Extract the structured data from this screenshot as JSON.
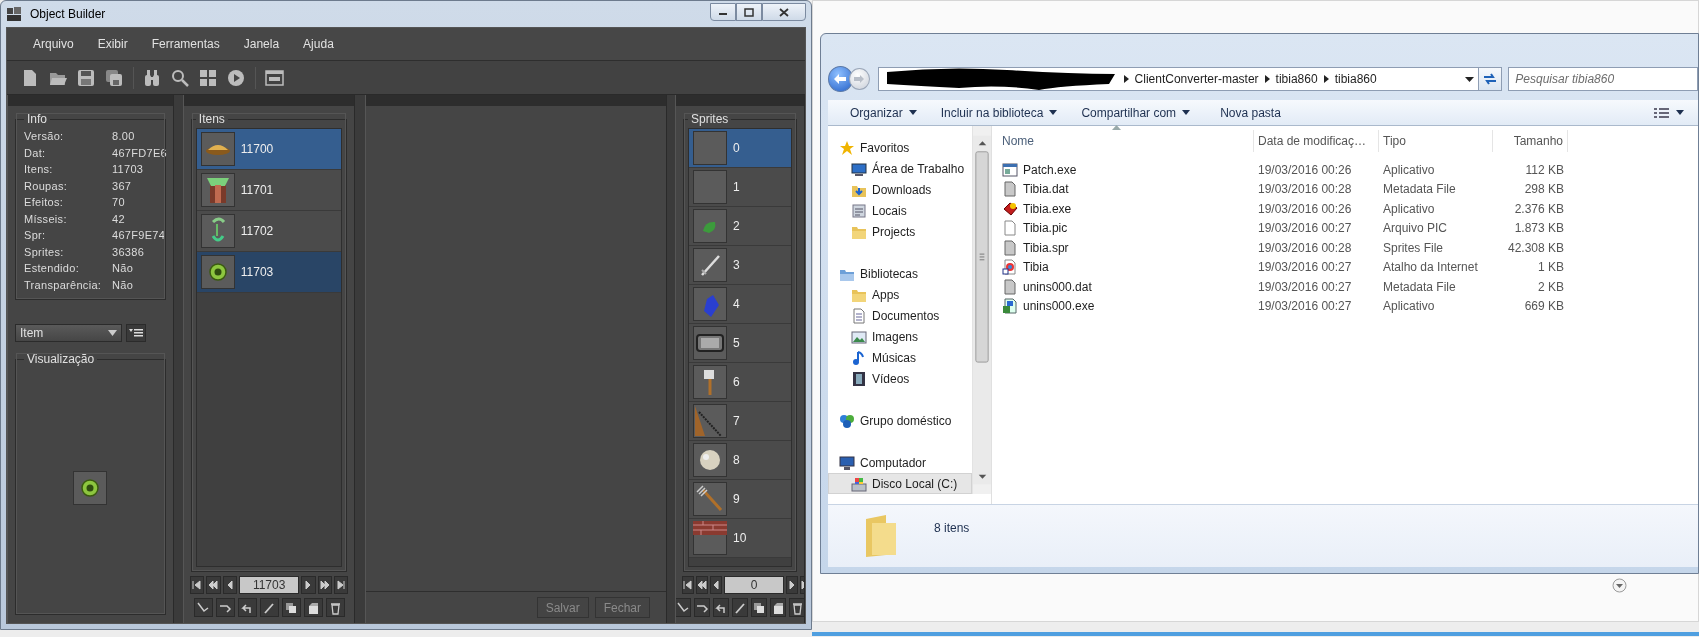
{
  "object_builder": {
    "title": "Object Builder",
    "menu": [
      "Arquivo",
      "Exibir",
      "Ferramentas",
      "Janela",
      "Ajuda"
    ],
    "info": {
      "title": "Info",
      "fields": [
        {
          "label": "Versão:",
          "value": "8.00"
        },
        {
          "label": "Dat:",
          "value": "467FD7E6"
        },
        {
          "label": "Itens:",
          "value": "11703"
        },
        {
          "label": "Roupas:",
          "value": "367"
        },
        {
          "label": "Efeitos:",
          "value": "70"
        },
        {
          "label": "Mísseis:",
          "value": "42"
        },
        {
          "label": "Spr:",
          "value": "467F9E74"
        },
        {
          "label": "Sprites:",
          "value": "36386"
        },
        {
          "label": "Estendido:",
          "value": "Não"
        },
        {
          "label": "Transparência:",
          "value": "Não"
        }
      ]
    },
    "category": {
      "value": "Item"
    },
    "preview": {
      "title": "Visualização",
      "kind": "shield"
    },
    "items": {
      "title": "Itens",
      "rows": [
        {
          "id": "11700",
          "kind": "hat",
          "selected": false,
          "hovered": true
        },
        {
          "id": "11701",
          "kind": "armor",
          "selected": false,
          "hovered": false
        },
        {
          "id": "11702",
          "kind": "amulet",
          "selected": false,
          "hovered": false
        },
        {
          "id": "11703",
          "kind": "shield",
          "selected": true,
          "hovered": false
        }
      ],
      "page": "11703"
    },
    "editor": {
      "buttons": [
        {
          "label": "Salvar",
          "disabled": true
        },
        {
          "label": "Fechar",
          "disabled": true
        }
      ]
    },
    "sprites": {
      "title": "Sprites",
      "rows": [
        {
          "id": "0",
          "kind": "empty",
          "selected": true
        },
        {
          "id": "1",
          "kind": "empty",
          "selected": false
        },
        {
          "id": "2",
          "kind": "leaf",
          "selected": false
        },
        {
          "id": "3",
          "kind": "sword",
          "selected": false
        },
        {
          "id": "4",
          "kind": "bottle",
          "selected": false
        },
        {
          "id": "5",
          "kind": "frame",
          "selected": false
        },
        {
          "id": "6",
          "kind": "axe",
          "selected": false
        },
        {
          "id": "7",
          "kind": "rope",
          "selected": false
        },
        {
          "id": "8",
          "kind": "dust",
          "selected": false
        },
        {
          "id": "9",
          "kind": "fork",
          "selected": false
        },
        {
          "id": "10",
          "kind": "brick",
          "selected": false
        }
      ],
      "page": "0"
    }
  },
  "explorer": {
    "breadcrumb": [
      "ClientConverter-master",
      "tibia860",
      "tibia860"
    ],
    "search": {
      "placeholder": "Pesquisar tibia860"
    },
    "commands": [
      {
        "label": "Organizar",
        "dropdown": true
      },
      {
        "label": "Incluir na biblioteca",
        "dropdown": true
      },
      {
        "label": "Compartilhar com",
        "dropdown": true
      },
      {
        "label": "Nova pasta",
        "dropdown": false
      }
    ],
    "nav": [
      {
        "label": "Favoritos",
        "kind": "star",
        "selected": false,
        "children": [
          {
            "label": "Área de Trabalho",
            "kind": "desktop",
            "selected": false
          },
          {
            "label": "Downloads",
            "kind": "downloads",
            "selected": false
          },
          {
            "label": "Locais",
            "kind": "places",
            "selected": false
          },
          {
            "label": "Projects",
            "kind": "folder",
            "selected": false
          }
        ]
      },
      {
        "label": "Bibliotecas",
        "kind": "library",
        "selected": false,
        "children": [
          {
            "label": "Apps",
            "kind": "folder",
            "selected": false
          },
          {
            "label": "Documentos",
            "kind": "document",
            "selected": false
          },
          {
            "label": "Imagens",
            "kind": "images",
            "selected": false
          },
          {
            "label": "Músicas",
            "kind": "music",
            "selected": false
          },
          {
            "label": "Vídeos",
            "kind": "video",
            "selected": false
          }
        ]
      },
      {
        "label": "Grupo doméstico",
        "kind": "homegroup",
        "selected": false
      },
      {
        "label": "Computador",
        "kind": "computer",
        "selected": false,
        "children": [
          {
            "label": "Disco Local (C:)",
            "kind": "drive",
            "selected": true
          }
        ]
      }
    ],
    "columns": [
      "Nome",
      "Data de modificaç…",
      "Tipo",
      "Tamanho"
    ],
    "files": [
      {
        "name": "Patch.exe",
        "kind": "app",
        "modified": "19/03/2016 00:26",
        "type": "Aplicativo",
        "size": "112 KB"
      },
      {
        "name": "Tibia.dat",
        "kind": "file",
        "modified": "19/03/2016 00:28",
        "type": "Metadata File",
        "size": "298 KB"
      },
      {
        "name": "Tibia.exe",
        "kind": "game",
        "modified": "19/03/2016 00:26",
        "type": "Aplicativo",
        "size": "2.376 KB"
      },
      {
        "name": "Tibia.pic",
        "kind": "blank",
        "modified": "19/03/2016 00:27",
        "type": "Arquivo PIC",
        "size": "1.873 KB"
      },
      {
        "name": "Tibia.spr",
        "kind": "file",
        "modified": "19/03/2016 00:28",
        "type": "Sprites File",
        "size": "42.308 KB"
      },
      {
        "name": "Tibia",
        "kind": "web",
        "modified": "19/03/2016 00:27",
        "type": "Atalho da Internet",
        "size": "1 KB"
      },
      {
        "name": "unins000.dat",
        "kind": "file",
        "modified": "19/03/2016 00:27",
        "type": "Metadata File",
        "size": "2 KB"
      },
      {
        "name": "unins000.exe",
        "kind": "installer",
        "modified": "19/03/2016 00:27",
        "type": "Aplicativo",
        "size": "669 KB"
      }
    ],
    "status": "8 itens"
  }
}
